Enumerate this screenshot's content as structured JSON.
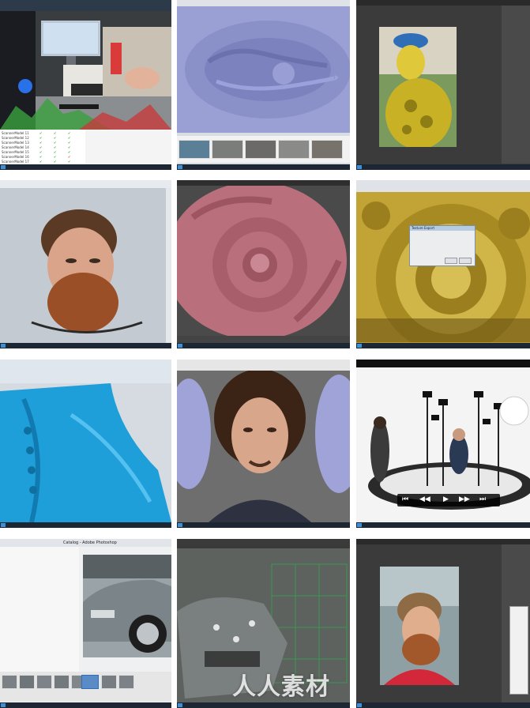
{
  "tiles": [
    {
      "id": "scanner-desk",
      "bg": "#2a2d33",
      "taskbar_time": ""
    },
    {
      "id": "zbrush-relief",
      "bg": "#8f96c9"
    },
    {
      "id": "photoshop-statue",
      "bg": "#3b3b3b"
    },
    {
      "id": "head-scan",
      "bg": "#c9cfd6"
    },
    {
      "id": "pink-relief",
      "bg": "#b46a78"
    },
    {
      "id": "yellow-detail",
      "bg": "#b79a2a"
    },
    {
      "id": "blue-boot",
      "bg": "#1f9ed8"
    },
    {
      "id": "character-portrait",
      "bg": "#6a6a6a"
    },
    {
      "id": "photo-studio",
      "bg": "#f2f2f2"
    },
    {
      "id": "car-photo",
      "bg": "#e9ecef"
    },
    {
      "id": "car-mesh",
      "bg": "#4a4f4e"
    },
    {
      "id": "photoshop-portrait",
      "bg": "#3b3b3b"
    }
  ],
  "scanner_list": {
    "rows": [
      "ScannerModel 11",
      "ScannerModel 12",
      "ScannerModel 13",
      "ScannerModel 14",
      "ScannerModel 15",
      "ScannerModel 16",
      "ScannerModel 17"
    ]
  },
  "dialog": {
    "title": "Texture Export"
  },
  "photo_app": {
    "title": "Catalog - Adobe Photoshop"
  },
  "media_controls": [
    "⏮",
    "◀◀",
    "▶",
    "▶▶",
    "⏭"
  ],
  "watermark": {
    "text": "人人素材"
  },
  "colors": {
    "taskbar": "#1c2733",
    "accent": "#3d8fd6",
    "watermark": "#ffffff"
  }
}
